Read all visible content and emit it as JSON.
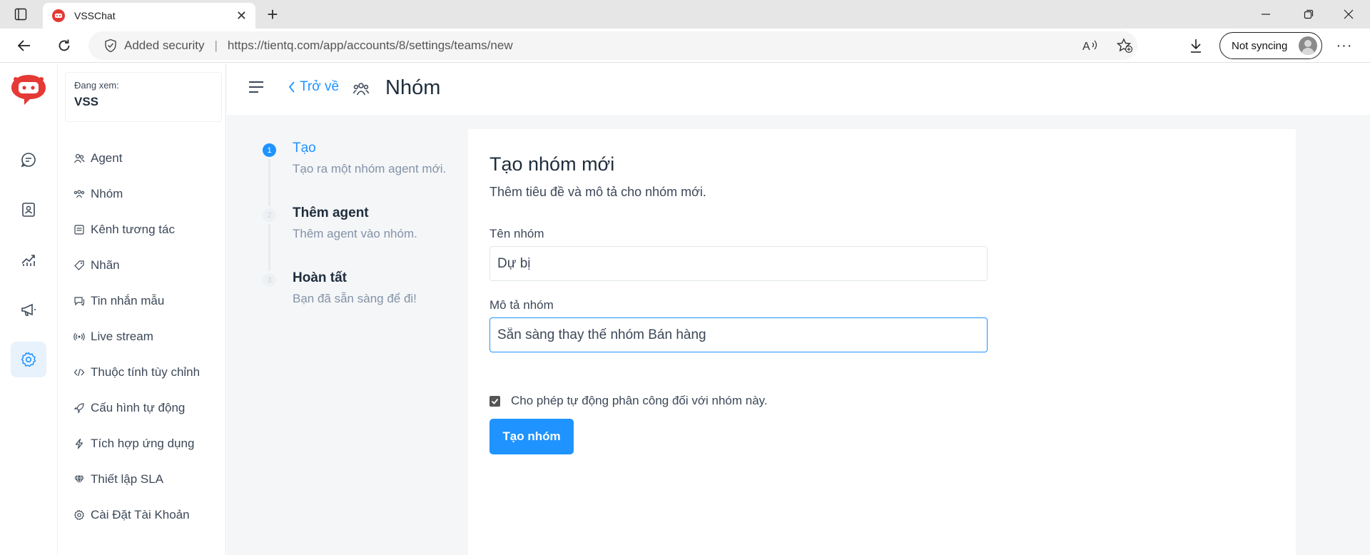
{
  "browser": {
    "tab_title": "VSSChat",
    "security_label": "Added security",
    "url": "https://tientq.com/app/accounts/8/settings/teams/new",
    "sync_label": "Not syncing"
  },
  "account": {
    "viewing_label": "Đang xem:",
    "name": "VSS"
  },
  "settings_menu": {
    "items": [
      {
        "label": "Agent",
        "icon": "agents-icon"
      },
      {
        "label": "Nhóm",
        "icon": "teams-icon"
      },
      {
        "label": "Kênh tương tác",
        "icon": "inbox-icon"
      },
      {
        "label": "Nhãn",
        "icon": "tag-icon"
      },
      {
        "label": "Tin nhắn mẫu",
        "icon": "chat-icon"
      },
      {
        "label": "Live stream",
        "icon": "broadcast-icon"
      },
      {
        "label": "Thuộc tính tùy chỉnh",
        "icon": "code-icon"
      },
      {
        "label": "Cấu hình tự động",
        "icon": "rocket-icon"
      },
      {
        "label": "Tích hợp ứng dụng",
        "icon": "flash-icon"
      },
      {
        "label": "Thiết lập SLA",
        "icon": "diamond-icon"
      },
      {
        "label": "Cài Đặt Tài Khoản",
        "icon": "gear-icon"
      }
    ]
  },
  "header": {
    "back_label": "Trở về",
    "title": "Nhóm"
  },
  "wizard": {
    "steps": [
      {
        "number": "1",
        "title": "Tạo",
        "description": "Tạo ra một nhóm agent mới."
      },
      {
        "number": "2",
        "title": "Thêm agent",
        "description": "Thêm agent vào nhóm."
      },
      {
        "number": "3",
        "title": "Hoàn tất",
        "description": "Bạn đã sẵn sàng để đi!"
      }
    ]
  },
  "form": {
    "heading": "Tạo nhóm mới",
    "subheading": "Thêm tiêu đề và mô tả cho nhóm mới.",
    "name_label": "Tên nhóm",
    "name_value": "Dự bị",
    "description_label": "Mô tả nhóm",
    "description_value": "Sẵn sàng thay thế nhóm Bán hàng",
    "auto_assign_label": "Cho phép tự động phân công đối với nhóm này.",
    "auto_assign_checked": true,
    "submit_label": "Tạo nhóm"
  },
  "colors": {
    "accent": "#1f93ff",
    "brand_red": "#e53935"
  }
}
